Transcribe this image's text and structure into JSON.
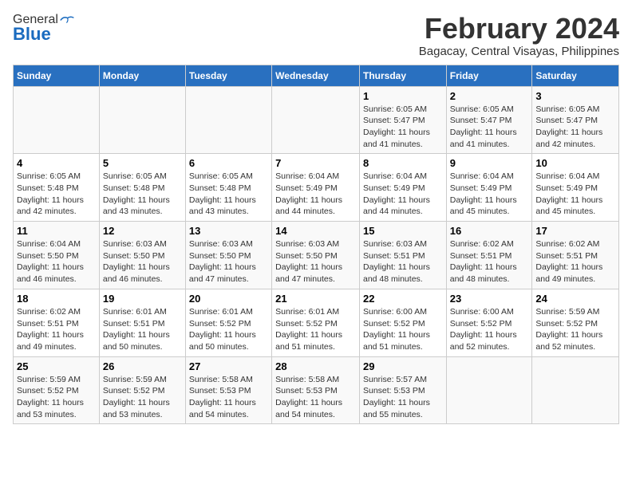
{
  "logo": {
    "general": "General",
    "blue": "Blue"
  },
  "header": {
    "month_year": "February 2024",
    "location": "Bagacay, Central Visayas, Philippines"
  },
  "days_of_week": [
    "Sunday",
    "Monday",
    "Tuesday",
    "Wednesday",
    "Thursday",
    "Friday",
    "Saturday"
  ],
  "weeks": [
    {
      "days": [
        {
          "number": "",
          "info": ""
        },
        {
          "number": "",
          "info": ""
        },
        {
          "number": "",
          "info": ""
        },
        {
          "number": "",
          "info": ""
        },
        {
          "number": "1",
          "info": "Sunrise: 6:05 AM\nSunset: 5:47 PM\nDaylight: 11 hours and 41 minutes."
        },
        {
          "number": "2",
          "info": "Sunrise: 6:05 AM\nSunset: 5:47 PM\nDaylight: 11 hours and 41 minutes."
        },
        {
          "number": "3",
          "info": "Sunrise: 6:05 AM\nSunset: 5:47 PM\nDaylight: 11 hours and 42 minutes."
        }
      ]
    },
    {
      "days": [
        {
          "number": "4",
          "info": "Sunrise: 6:05 AM\nSunset: 5:48 PM\nDaylight: 11 hours and 42 minutes."
        },
        {
          "number": "5",
          "info": "Sunrise: 6:05 AM\nSunset: 5:48 PM\nDaylight: 11 hours and 43 minutes."
        },
        {
          "number": "6",
          "info": "Sunrise: 6:05 AM\nSunset: 5:48 PM\nDaylight: 11 hours and 43 minutes."
        },
        {
          "number": "7",
          "info": "Sunrise: 6:04 AM\nSunset: 5:49 PM\nDaylight: 11 hours and 44 minutes."
        },
        {
          "number": "8",
          "info": "Sunrise: 6:04 AM\nSunset: 5:49 PM\nDaylight: 11 hours and 44 minutes."
        },
        {
          "number": "9",
          "info": "Sunrise: 6:04 AM\nSunset: 5:49 PM\nDaylight: 11 hours and 45 minutes."
        },
        {
          "number": "10",
          "info": "Sunrise: 6:04 AM\nSunset: 5:49 PM\nDaylight: 11 hours and 45 minutes."
        }
      ]
    },
    {
      "days": [
        {
          "number": "11",
          "info": "Sunrise: 6:04 AM\nSunset: 5:50 PM\nDaylight: 11 hours and 46 minutes."
        },
        {
          "number": "12",
          "info": "Sunrise: 6:03 AM\nSunset: 5:50 PM\nDaylight: 11 hours and 46 minutes."
        },
        {
          "number": "13",
          "info": "Sunrise: 6:03 AM\nSunset: 5:50 PM\nDaylight: 11 hours and 47 minutes."
        },
        {
          "number": "14",
          "info": "Sunrise: 6:03 AM\nSunset: 5:50 PM\nDaylight: 11 hours and 47 minutes."
        },
        {
          "number": "15",
          "info": "Sunrise: 6:03 AM\nSunset: 5:51 PM\nDaylight: 11 hours and 48 minutes."
        },
        {
          "number": "16",
          "info": "Sunrise: 6:02 AM\nSunset: 5:51 PM\nDaylight: 11 hours and 48 minutes."
        },
        {
          "number": "17",
          "info": "Sunrise: 6:02 AM\nSunset: 5:51 PM\nDaylight: 11 hours and 49 minutes."
        }
      ]
    },
    {
      "days": [
        {
          "number": "18",
          "info": "Sunrise: 6:02 AM\nSunset: 5:51 PM\nDaylight: 11 hours and 49 minutes."
        },
        {
          "number": "19",
          "info": "Sunrise: 6:01 AM\nSunset: 5:51 PM\nDaylight: 11 hours and 50 minutes."
        },
        {
          "number": "20",
          "info": "Sunrise: 6:01 AM\nSunset: 5:52 PM\nDaylight: 11 hours and 50 minutes."
        },
        {
          "number": "21",
          "info": "Sunrise: 6:01 AM\nSunset: 5:52 PM\nDaylight: 11 hours and 51 minutes."
        },
        {
          "number": "22",
          "info": "Sunrise: 6:00 AM\nSunset: 5:52 PM\nDaylight: 11 hours and 51 minutes."
        },
        {
          "number": "23",
          "info": "Sunrise: 6:00 AM\nSunset: 5:52 PM\nDaylight: 11 hours and 52 minutes."
        },
        {
          "number": "24",
          "info": "Sunrise: 5:59 AM\nSunset: 5:52 PM\nDaylight: 11 hours and 52 minutes."
        }
      ]
    },
    {
      "days": [
        {
          "number": "25",
          "info": "Sunrise: 5:59 AM\nSunset: 5:52 PM\nDaylight: 11 hours and 53 minutes."
        },
        {
          "number": "26",
          "info": "Sunrise: 5:59 AM\nSunset: 5:52 PM\nDaylight: 11 hours and 53 minutes."
        },
        {
          "number": "27",
          "info": "Sunrise: 5:58 AM\nSunset: 5:53 PM\nDaylight: 11 hours and 54 minutes."
        },
        {
          "number": "28",
          "info": "Sunrise: 5:58 AM\nSunset: 5:53 PM\nDaylight: 11 hours and 54 minutes."
        },
        {
          "number": "29",
          "info": "Sunrise: 5:57 AM\nSunset: 5:53 PM\nDaylight: 11 hours and 55 minutes."
        },
        {
          "number": "",
          "info": ""
        },
        {
          "number": "",
          "info": ""
        }
      ]
    }
  ]
}
